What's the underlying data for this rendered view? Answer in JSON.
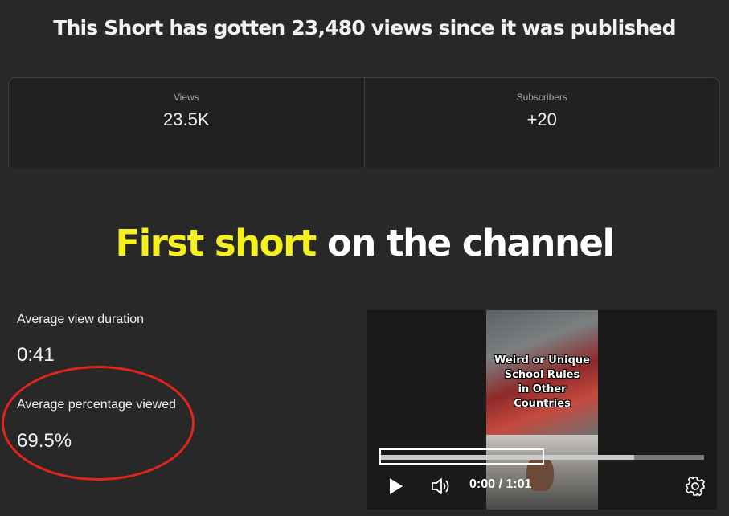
{
  "headline": "This Short has gotten 23,480 views since it was published",
  "stats": [
    {
      "label": "Views",
      "value": "23.5K"
    },
    {
      "label": "Subscribers",
      "value": "+20"
    }
  ],
  "banner": {
    "highlight": "First short",
    "rest": "on the channel"
  },
  "metrics": {
    "avg_view_duration_label": "Average view duration",
    "avg_view_duration_value": "0:41",
    "avg_pct_viewed_label": "Average percentage viewed",
    "avg_pct_viewed_value": "69.5%"
  },
  "player": {
    "thumbnail_caption_lines": [
      "Weird or Unique",
      "School Rules",
      "in Other",
      "Countries"
    ],
    "time_display": "0:00 / 1:01",
    "progress_buffered_fraction": 0.785
  },
  "colors": {
    "highlight": "#f5f020",
    "annotation": "#e3241b",
    "background": "#282828"
  }
}
